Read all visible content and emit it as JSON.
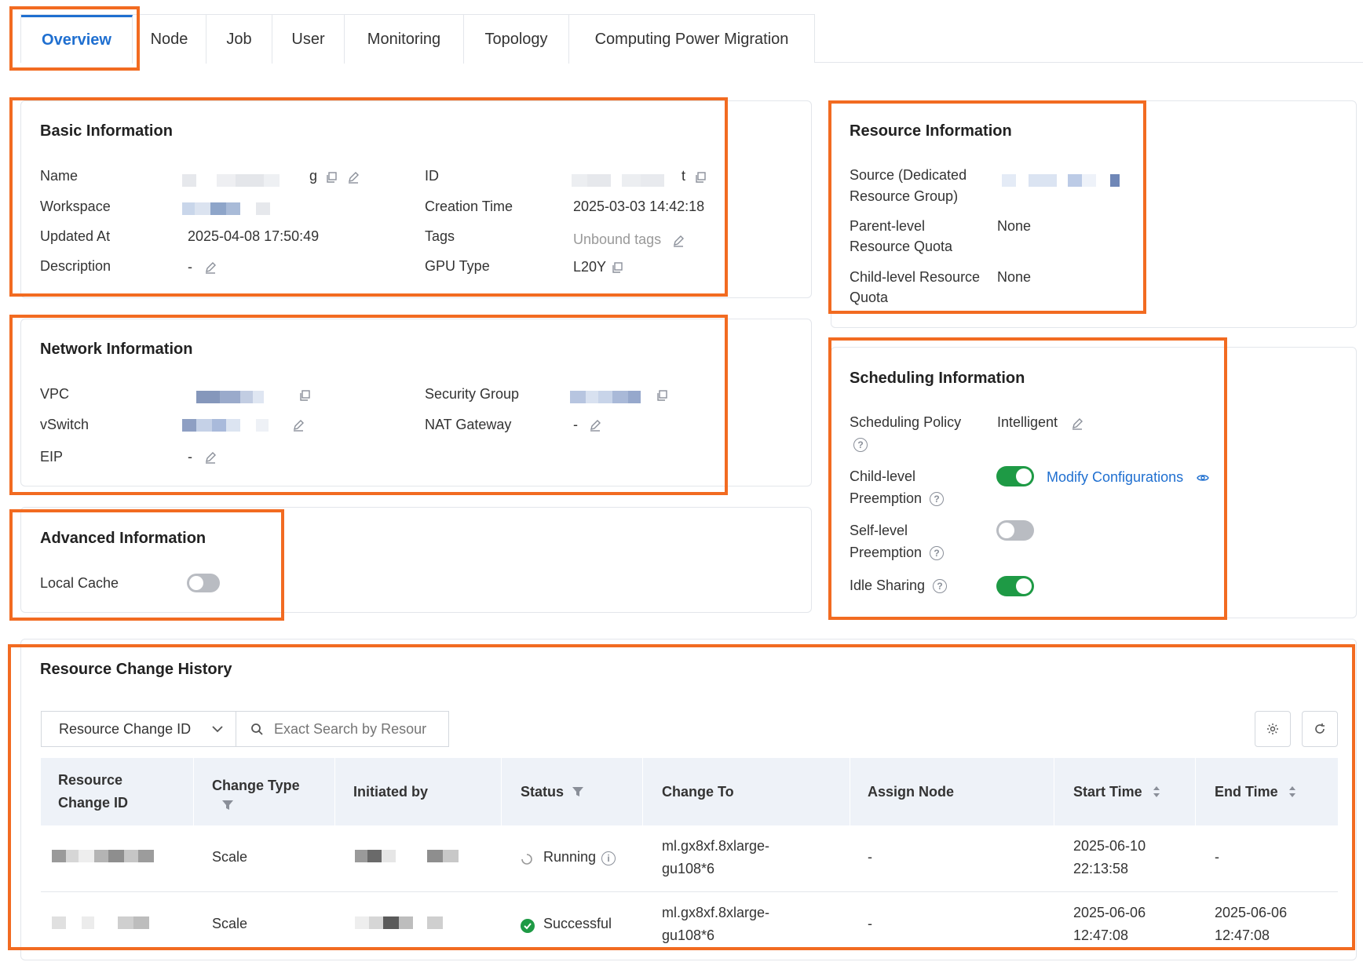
{
  "tabs": [
    "Overview",
    "Node",
    "Job",
    "User",
    "Monitoring",
    "Topology",
    "Computing Power Migration"
  ],
  "basic": {
    "title": "Basic Information",
    "name_label": "Name",
    "id_label": "ID",
    "workspace_label": "Workspace",
    "creation_time_label": "Creation Time",
    "creation_time": "2025-03-03 14:42:18",
    "updated_at_label": "Updated At",
    "updated_at": "2025-04-08 17:50:49",
    "tags_label": "Tags",
    "tags_value": "Unbound tags",
    "description_label": "Description",
    "description": "-",
    "gpu_type_label": "GPU Type",
    "gpu_type": "L20Y",
    "name_tail": "g",
    "id_tail": "t"
  },
  "network": {
    "title": "Network Information",
    "vpc_label": "VPC",
    "security_group_label": "Security Group",
    "vswitch_label": "vSwitch",
    "nat_label": "NAT Gateway",
    "nat_value": "-",
    "eip_label": "EIP",
    "eip_value": "-"
  },
  "advanced": {
    "title": "Advanced Information",
    "local_cache_label": "Local Cache",
    "local_cache_on": false
  },
  "resource": {
    "title": "Resource Information",
    "source_label_1": "Source (Dedicated",
    "source_label_2": "Resource Group)",
    "parent_label_1": "Parent-level",
    "parent_label_2": "Resource Quota",
    "parent_value": "None",
    "child_label_1": "Child-level Resource",
    "child_label_2": "Quota",
    "child_value": "None"
  },
  "scheduling": {
    "title": "Scheduling Information",
    "policy_label": "Scheduling Policy",
    "policy_value": "Intelligent",
    "child_preempt_label_1": "Child-level",
    "child_preempt_label_2": "Preemption",
    "child_preempt_on": true,
    "modify_link": "Modify Configurations",
    "self_preempt_label_1": "Self-level",
    "self_preempt_label_2": "Preemption",
    "self_preempt_on": false,
    "idle_label": "Idle Sharing",
    "idle_on": true
  },
  "history": {
    "title": "Resource Change History",
    "filter_select": "Resource Change ID",
    "search_placeholder": "Exact Search by Resour",
    "columns": {
      "id_1": "Resource",
      "id_2": "Change ID",
      "type": "Change Type",
      "initiated": "Initiated by",
      "status": "Status",
      "change_to": "Change To",
      "assign": "Assign Node",
      "start": "Start Time",
      "end": "End Time"
    },
    "rows": [
      {
        "type": "Scale",
        "status": "Running",
        "change_to_1": "ml.gx8xf.8xlarge-",
        "change_to_2": "gu108*6",
        "assign": "-",
        "start_1": "2025-06-10",
        "start_2": "22:13:58",
        "end": "-"
      },
      {
        "type": "Scale",
        "status": "Successful",
        "change_to_1": "ml.gx8xf.8xlarge-",
        "change_to_2": "gu108*6",
        "assign": "-",
        "start_1": "2025-06-06",
        "start_2": "12:47:08",
        "end_1": "2025-06-06",
        "end_2": "12:47:08"
      }
    ]
  },
  "colors": {
    "accent": "#1f6fd0",
    "highlight": "#f26b21",
    "toggle_on": "#1e9a45",
    "toggle_off": "#b9bcc2"
  }
}
